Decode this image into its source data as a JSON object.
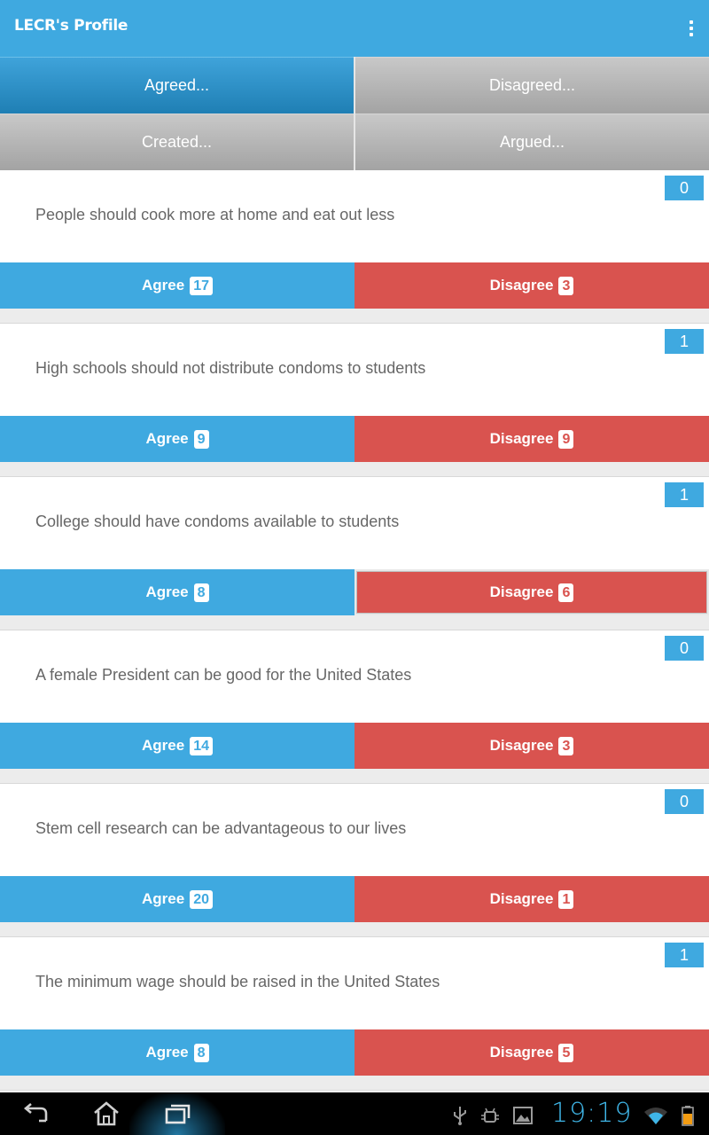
{
  "app": {
    "title": "LECR's Profile"
  },
  "tabs": [
    {
      "label": "Agreed...",
      "active": true
    },
    {
      "label": "Disagreed...",
      "active": false
    },
    {
      "label": "Created...",
      "active": false
    },
    {
      "label": "Argued...",
      "active": false
    }
  ],
  "items": [
    {
      "count": "0",
      "statement": "People should cook more at home and eat out less",
      "agree_label": "Agree",
      "agree_count": "17",
      "disagree_label": "Disagree",
      "disagree_count": "3"
    },
    {
      "count": "1",
      "statement": "High schools should not distribute condoms to students",
      "agree_label": "Agree",
      "agree_count": "9",
      "disagree_label": "Disagree",
      "disagree_count": "9"
    },
    {
      "count": "1",
      "statement": "College should have condoms available to students",
      "agree_label": "Agree",
      "agree_count": "8",
      "disagree_label": "Disagree",
      "disagree_count": "6"
    },
    {
      "count": "0",
      "statement": "A female President can be good for the United States",
      "agree_label": "Agree",
      "agree_count": "14",
      "disagree_label": "Disagree",
      "disagree_count": "3"
    },
    {
      "count": "0",
      "statement": "Stem cell research can be advantageous to our lives",
      "agree_label": "Agree",
      "agree_count": "20",
      "disagree_label": "Disagree",
      "disagree_count": "1"
    },
    {
      "count": "1",
      "statement": "The minimum wage should be raised in the United States",
      "agree_label": "Agree",
      "agree_count": "8",
      "disagree_label": "Disagree",
      "disagree_count": "5"
    }
  ],
  "status": {
    "time": "19:19"
  },
  "icons": {
    "menu": "overflow-menu-icon",
    "back": "back-icon",
    "home": "home-icon",
    "recents": "recent-apps-icon",
    "usb": "usb-icon",
    "debug": "android-debug-icon",
    "gallery": "image-icon",
    "wifi": "wifi-icon",
    "battery": "battery-icon"
  },
  "colors": {
    "accent": "#3fa9e0",
    "danger": "#d9534f",
    "clock": "#3fb6e8"
  }
}
